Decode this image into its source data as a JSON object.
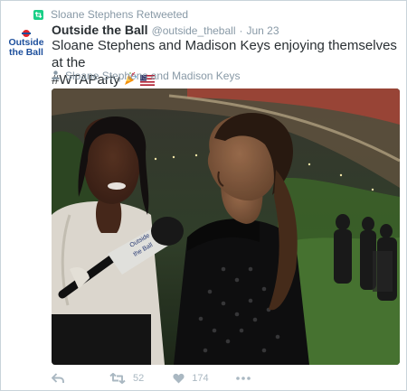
{
  "retweet_bar": {
    "text": "Sloane Stephens Retweeted",
    "icon": "retweet-icon",
    "icon_color": "#19cf86"
  },
  "avatar": {
    "line1": "Outside",
    "line2": "the Ball",
    "colors": {
      "blue": "#1d4f9c",
      "red": "#e1242b"
    }
  },
  "tweet": {
    "name": "Outside the Ball",
    "handle": "@outside_theball",
    "separator": "·",
    "time": "Jun 23",
    "text_line1": "Sloane Stephens and Madison Keys enjoying themselves at the",
    "text_line2": "#WTAParty",
    "emojis": [
      "party-popper-icon",
      "us-flag-icon"
    ],
    "tagged": "Sloane Stephens and Madison Keys",
    "tagged_icon": "person-icon"
  },
  "photo": {
    "microphone_text_line1": "Outside",
    "microphone_text_line2": "the Ball"
  },
  "actions": {
    "reply_icon": "reply-icon",
    "retweet_count": "52",
    "like_count": "174",
    "more_icon": "more-icon"
  },
  "colors": {
    "text": "#292f33",
    "muted": "#8899a6",
    "action_gray": "#aab8c2"
  }
}
